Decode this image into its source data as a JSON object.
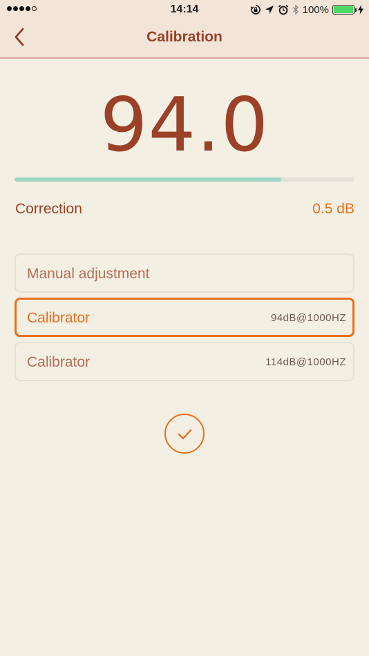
{
  "status_bar": {
    "time": "14:14",
    "battery_text": "100%",
    "battery_level": 1.0,
    "signal_bars_filled": 4,
    "signal_bars_total": 5,
    "icons": [
      "lock-rotation-icon",
      "location-arrow-icon",
      "alarm-icon",
      "bluetooth-icon",
      "battery-icon",
      "charging-bolt-icon"
    ]
  },
  "nav": {
    "title": "Calibration",
    "back_icon": "chevron-left-icon"
  },
  "reading": {
    "value": "94.0",
    "level_fraction": 0.785
  },
  "correction": {
    "label": "Correction",
    "value": "0.5 dB"
  },
  "options": [
    {
      "label": "Manual adjustment",
      "value": "",
      "selected": false
    },
    {
      "label": "Calibrator",
      "value": "94dB@1000HZ",
      "selected": true
    },
    {
      "label": "Calibrator",
      "value": "114dB@1000HZ",
      "selected": false
    }
  ],
  "confirm": {
    "icon": "checkmark-icon"
  },
  "colors": {
    "background": "#f3efe3",
    "header": "#f2e4d7",
    "header_border": "#e0a3a3",
    "primary_text": "#9b4128",
    "accent": "#e8701f",
    "progress": "#9ed5c4",
    "battery": "#4cd964"
  }
}
